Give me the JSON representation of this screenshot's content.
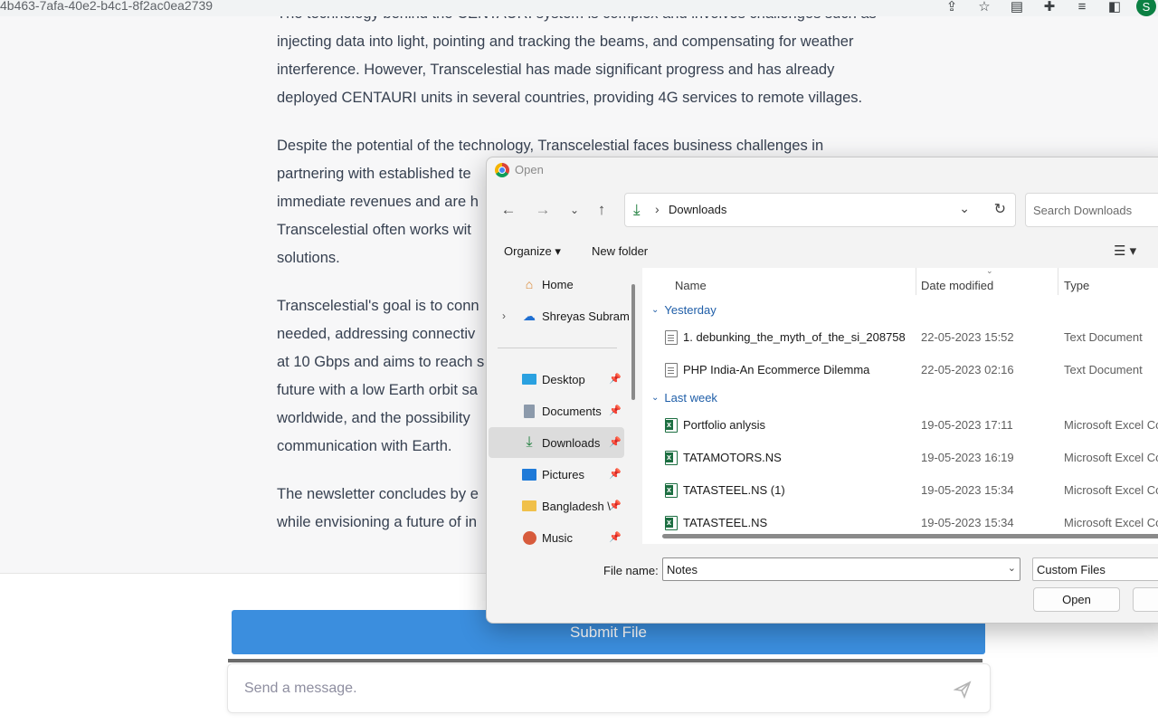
{
  "browser": {
    "url_fragment": "4b463-7afa-40e2-b4c1-8f2ac0ea2739",
    "avatar_letter": "S"
  },
  "chat": {
    "paragraphs": [
      "The technology behind the CENTAURI system is complex and involves challenges such as injecting data into light, pointing and tracking the beams, and compensating for weather interference. However, Transcelestial has made significant progress and has already deployed CENTAURI units in several countries, providing 4G services to remote villages.",
      "Despite the potential of the technology, Transcelestial faces business challenges in partnering with established telecom operators who prioritize immediate revenues and are hesitant to adopt new technology. Transcelestial often works with smaller operators willing to try innovative solutions.",
      "Transcelestial's goal is to connect the unconnected, providing internet where it is needed, addressing connectivity gaps. The company's CENTAURI system operates at 10 Gbps and aims to reach speeds of 100 Gbps. It also envisions a future with a low Earth orbit satellite network for laser-based connectivity worldwide, and the possibility of lunar and interplanetary laser communication with Earth.",
      "The newsletter concludes by emphasizing Transcelestial's vision of connectivity while envisioning a future of interplanetary communication."
    ],
    "lines": [
      "The technology behind the CENTAURI system is complex and involves challenges such as",
      "injecting data into light, pointing and tracking the beams, and compensating for weather",
      "interference. However, Transcelestial has made significant progress and has already",
      "deployed CENTAURI units in several countries, providing 4G services to remote villages.",
      "Despite the potential of the technology, Transcelestial faces business challenges in",
      "partnering with established te",
      "immediate revenues and are h",
      "Transcelestial often works wit",
      "solutions.",
      "Transcelestial's goal is to conn",
      "needed, addressing connectiv",
      "at 10 Gbps and aims to reach s",
      "future with a low Earth orbit sa",
      "worldwide, and the possibility",
      "communication with Earth.",
      "The newsletter concludes by e",
      "while envisioning a future of in"
    ],
    "submit_label": "Submit File",
    "message_placeholder": "Send a message."
  },
  "dialog": {
    "title": "Open",
    "address_folder": "Downloads",
    "search_placeholder": "Search Downloads",
    "organize_label": "Organize ▾",
    "new_folder_label": "New folder",
    "nav_items": [
      {
        "label": "Home",
        "icon": "home-icon"
      },
      {
        "label": "Shreyas Subram",
        "icon": "onedrive-cloud-icon"
      },
      {
        "label": "Desktop",
        "icon": "desktop-folder-icon"
      },
      {
        "label": "Documents",
        "icon": "documents-folder-icon"
      },
      {
        "label": "Downloads",
        "icon": "downloads-icon"
      },
      {
        "label": "Pictures",
        "icon": "pictures-folder-icon"
      },
      {
        "label": "Bangladesh \\",
        "icon": "folder-icon"
      },
      {
        "label": "Music",
        "icon": "music-folder-icon"
      }
    ],
    "columns": {
      "name": "Name",
      "date": "Date modified",
      "type": "Type"
    },
    "groups": [
      {
        "label": "Yesterday",
        "files": [
          {
            "name": "1. debunking_the_myth_of_the_si_208758",
            "date": "22-05-2023 15:52",
            "type": "Text Document",
            "icon": "text-file-icon"
          },
          {
            "name": "PHP India-An Ecommerce Dilemma",
            "date": "22-05-2023 02:16",
            "type": "Text Document",
            "icon": "text-file-icon"
          }
        ]
      },
      {
        "label": "Last week",
        "files": [
          {
            "name": "Portfolio anlysis",
            "date": "19-05-2023 17:11",
            "type": "Microsoft Excel Co",
            "icon": "excel-file-icon"
          },
          {
            "name": "TATAMOTORS.NS",
            "date": "19-05-2023 16:19",
            "type": "Microsoft Excel Co",
            "icon": "excel-file-icon"
          },
          {
            "name": "TATASTEEL.NS (1)",
            "date": "19-05-2023 15:34",
            "type": "Microsoft Excel Co",
            "icon": "excel-file-icon"
          },
          {
            "name": "TATASTEEL.NS",
            "date": "19-05-2023 15:34",
            "type": "Microsoft Excel Co",
            "icon": "excel-file-icon"
          }
        ]
      }
    ],
    "file_name_label": "File name:",
    "file_name_value": "Notes",
    "file_type_value": "Custom Files",
    "open_label": "Open"
  }
}
